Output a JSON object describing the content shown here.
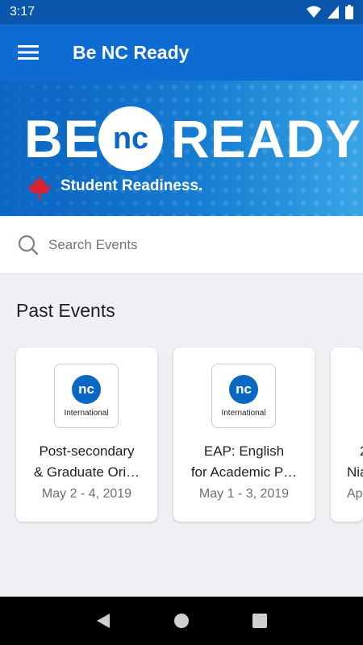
{
  "status_bar": {
    "time": "3:17",
    "icons": [
      "wifi-icon",
      "signal-icon",
      "battery-icon"
    ]
  },
  "app_bar": {
    "title": "Be NC Ready",
    "menu_icon": "menu-icon"
  },
  "banner": {
    "word_be": "BE",
    "word_nc": "nc",
    "word_ready": "READY",
    "tagline": "Student Readiness.",
    "leaf_icon": "maple-leaf-icon"
  },
  "search": {
    "placeholder": "Search Events",
    "value": ""
  },
  "section": {
    "title": "Past Events"
  },
  "events": [
    {
      "logo_mark": "nc",
      "logo_caption": "International",
      "title_line1": "Post-secondary",
      "title_line2": "& Graduate Ori…",
      "date": "May 2 - 4, 2019"
    },
    {
      "logo_mark": "nc",
      "logo_caption": "International",
      "title_line1": "EAP: English",
      "title_line2": "for Academic P…",
      "date": "May 1 - 3, 2019"
    },
    {
      "title_line1": "2",
      "title_line2": "Nia",
      "date": "Ap"
    }
  ],
  "colors": {
    "primary": "#0d6bd1",
    "status_bar": "#0a56ad",
    "background": "#eef0f4"
  },
  "nav": {
    "icons": [
      "back-icon",
      "home-icon",
      "recents-icon"
    ]
  }
}
